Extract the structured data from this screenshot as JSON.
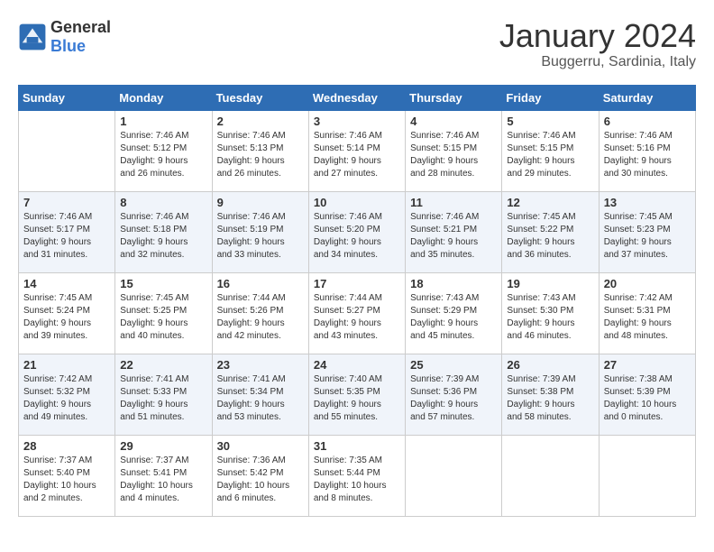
{
  "logo": {
    "general": "General",
    "blue": "Blue"
  },
  "header": {
    "title": "January 2024",
    "subtitle": "Buggerru, Sardinia, Italy"
  },
  "weekdays": [
    "Sunday",
    "Monday",
    "Tuesday",
    "Wednesday",
    "Thursday",
    "Friday",
    "Saturday"
  ],
  "weeks": [
    [
      {
        "day": "",
        "info": ""
      },
      {
        "day": "1",
        "info": "Sunrise: 7:46 AM\nSunset: 5:12 PM\nDaylight: 9 hours\nand 26 minutes."
      },
      {
        "day": "2",
        "info": "Sunrise: 7:46 AM\nSunset: 5:13 PM\nDaylight: 9 hours\nand 26 minutes."
      },
      {
        "day": "3",
        "info": "Sunrise: 7:46 AM\nSunset: 5:14 PM\nDaylight: 9 hours\nand 27 minutes."
      },
      {
        "day": "4",
        "info": "Sunrise: 7:46 AM\nSunset: 5:15 PM\nDaylight: 9 hours\nand 28 minutes."
      },
      {
        "day": "5",
        "info": "Sunrise: 7:46 AM\nSunset: 5:15 PM\nDaylight: 9 hours\nand 29 minutes."
      },
      {
        "day": "6",
        "info": "Sunrise: 7:46 AM\nSunset: 5:16 PM\nDaylight: 9 hours\nand 30 minutes."
      }
    ],
    [
      {
        "day": "7",
        "info": "Sunrise: 7:46 AM\nSunset: 5:17 PM\nDaylight: 9 hours\nand 31 minutes."
      },
      {
        "day": "8",
        "info": "Sunrise: 7:46 AM\nSunset: 5:18 PM\nDaylight: 9 hours\nand 32 minutes."
      },
      {
        "day": "9",
        "info": "Sunrise: 7:46 AM\nSunset: 5:19 PM\nDaylight: 9 hours\nand 33 minutes."
      },
      {
        "day": "10",
        "info": "Sunrise: 7:46 AM\nSunset: 5:20 PM\nDaylight: 9 hours\nand 34 minutes."
      },
      {
        "day": "11",
        "info": "Sunrise: 7:46 AM\nSunset: 5:21 PM\nDaylight: 9 hours\nand 35 minutes."
      },
      {
        "day": "12",
        "info": "Sunrise: 7:45 AM\nSunset: 5:22 PM\nDaylight: 9 hours\nand 36 minutes."
      },
      {
        "day": "13",
        "info": "Sunrise: 7:45 AM\nSunset: 5:23 PM\nDaylight: 9 hours\nand 37 minutes."
      }
    ],
    [
      {
        "day": "14",
        "info": "Sunrise: 7:45 AM\nSunset: 5:24 PM\nDaylight: 9 hours\nand 39 minutes."
      },
      {
        "day": "15",
        "info": "Sunrise: 7:45 AM\nSunset: 5:25 PM\nDaylight: 9 hours\nand 40 minutes."
      },
      {
        "day": "16",
        "info": "Sunrise: 7:44 AM\nSunset: 5:26 PM\nDaylight: 9 hours\nand 42 minutes."
      },
      {
        "day": "17",
        "info": "Sunrise: 7:44 AM\nSunset: 5:27 PM\nDaylight: 9 hours\nand 43 minutes."
      },
      {
        "day": "18",
        "info": "Sunrise: 7:43 AM\nSunset: 5:29 PM\nDaylight: 9 hours\nand 45 minutes."
      },
      {
        "day": "19",
        "info": "Sunrise: 7:43 AM\nSunset: 5:30 PM\nDaylight: 9 hours\nand 46 minutes."
      },
      {
        "day": "20",
        "info": "Sunrise: 7:42 AM\nSunset: 5:31 PM\nDaylight: 9 hours\nand 48 minutes."
      }
    ],
    [
      {
        "day": "21",
        "info": "Sunrise: 7:42 AM\nSunset: 5:32 PM\nDaylight: 9 hours\nand 49 minutes."
      },
      {
        "day": "22",
        "info": "Sunrise: 7:41 AM\nSunset: 5:33 PM\nDaylight: 9 hours\nand 51 minutes."
      },
      {
        "day": "23",
        "info": "Sunrise: 7:41 AM\nSunset: 5:34 PM\nDaylight: 9 hours\nand 53 minutes."
      },
      {
        "day": "24",
        "info": "Sunrise: 7:40 AM\nSunset: 5:35 PM\nDaylight: 9 hours\nand 55 minutes."
      },
      {
        "day": "25",
        "info": "Sunrise: 7:39 AM\nSunset: 5:36 PM\nDaylight: 9 hours\nand 57 minutes."
      },
      {
        "day": "26",
        "info": "Sunrise: 7:39 AM\nSunset: 5:38 PM\nDaylight: 9 hours\nand 58 minutes."
      },
      {
        "day": "27",
        "info": "Sunrise: 7:38 AM\nSunset: 5:39 PM\nDaylight: 10 hours\nand 0 minutes."
      }
    ],
    [
      {
        "day": "28",
        "info": "Sunrise: 7:37 AM\nSunset: 5:40 PM\nDaylight: 10 hours\nand 2 minutes."
      },
      {
        "day": "29",
        "info": "Sunrise: 7:37 AM\nSunset: 5:41 PM\nDaylight: 10 hours\nand 4 minutes."
      },
      {
        "day": "30",
        "info": "Sunrise: 7:36 AM\nSunset: 5:42 PM\nDaylight: 10 hours\nand 6 minutes."
      },
      {
        "day": "31",
        "info": "Sunrise: 7:35 AM\nSunset: 5:44 PM\nDaylight: 10 hours\nand 8 minutes."
      },
      {
        "day": "",
        "info": ""
      },
      {
        "day": "",
        "info": ""
      },
      {
        "day": "",
        "info": ""
      }
    ]
  ]
}
